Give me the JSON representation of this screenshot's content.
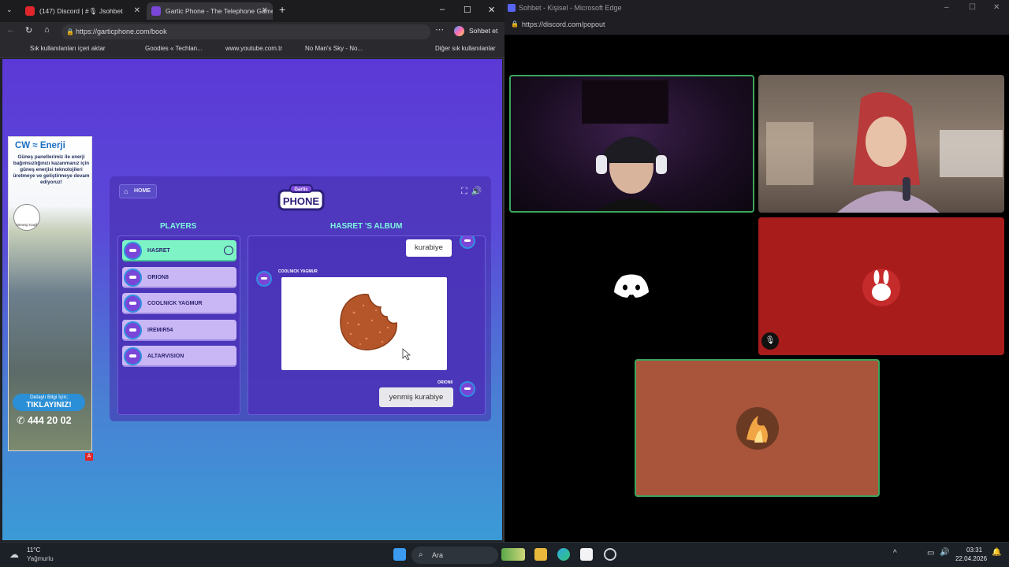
{
  "left_browser": {
    "tabs": [
      {
        "title": "(147) Discord | #🎙 Jsohbet",
        "icon_color": "#e0262a"
      },
      {
        "title": "Gartic Phone - The Telephone Game",
        "icon_color": "#7a46d8",
        "active": true
      }
    ],
    "new_tab_label": "+",
    "window_controls": [
      "–",
      "☐",
      "✕"
    ],
    "url": "https://garticphone.com/book",
    "toolbar_right_label": "Sohbet et",
    "bookmarks": [
      "Sık kullanılanları içeri aktar",
      "Goodies « Techlan...",
      "www.youtube.com.tr",
      "No Man's Sky - No...",
      "Diğer sık kullanılanlar"
    ]
  },
  "ad": {
    "title": "CW ≈ Enerji",
    "text": "Güneş panellerimiz ile enerji bağımsızlığınızı kazanmanız için güneş enerjisi teknolojileri üretmeye ve geliştirmeye devam ediyoruz!",
    "logo_text": "Denetçi Kaşif",
    "cta_line1": "Detaylı Bilgi İçin;",
    "cta_line2": "TIKLAYINIZ!",
    "phone": "444 20 02",
    "badge": "A"
  },
  "game": {
    "home_label": "HOME",
    "logo_top": "Gartic",
    "logo_bottom": "PHONE",
    "players_title": "PLAYERS",
    "album_title": "HASRET 'S ALBUM",
    "players": [
      {
        "name": "HASRET",
        "selected": true
      },
      {
        "name": "ORION8",
        "selected": false
      },
      {
        "name": "COOLNICK YAGMUR",
        "selected": false
      },
      {
        "name": "IREMIR54",
        "selected": false
      },
      {
        "name": "ALTARVISION",
        "selected": false
      }
    ],
    "album": {
      "first_guess": "kurabiye",
      "drawer_name": "COOLNICK YAGMUR",
      "drawing_subject": "cookie",
      "last_guesser": "ORION8",
      "last_guess": "yenmiş kurabiye"
    }
  },
  "right_browser": {
    "title": "Sohbet - Kişisel - Microsoft Edge",
    "url": "https://discord.com/popout",
    "tiles": [
      {
        "kind": "video-streamer-male",
        "speaking": true
      },
      {
        "kind": "video-streamer-female",
        "speaking": false
      },
      {
        "kind": "discord-logo",
        "speaking": false
      },
      {
        "kind": "avatar-bunny",
        "muted": true,
        "bg": "#a81c1c"
      },
      {
        "kind": "avatar-fire",
        "speaking": true,
        "bg": "#a8553b"
      }
    ]
  },
  "taskbar": {
    "weather_temp": "11°C",
    "weather_desc": "Yağmurlu",
    "search_label": "Ara",
    "time": "03:31",
    "date": "22.04.2026"
  }
}
